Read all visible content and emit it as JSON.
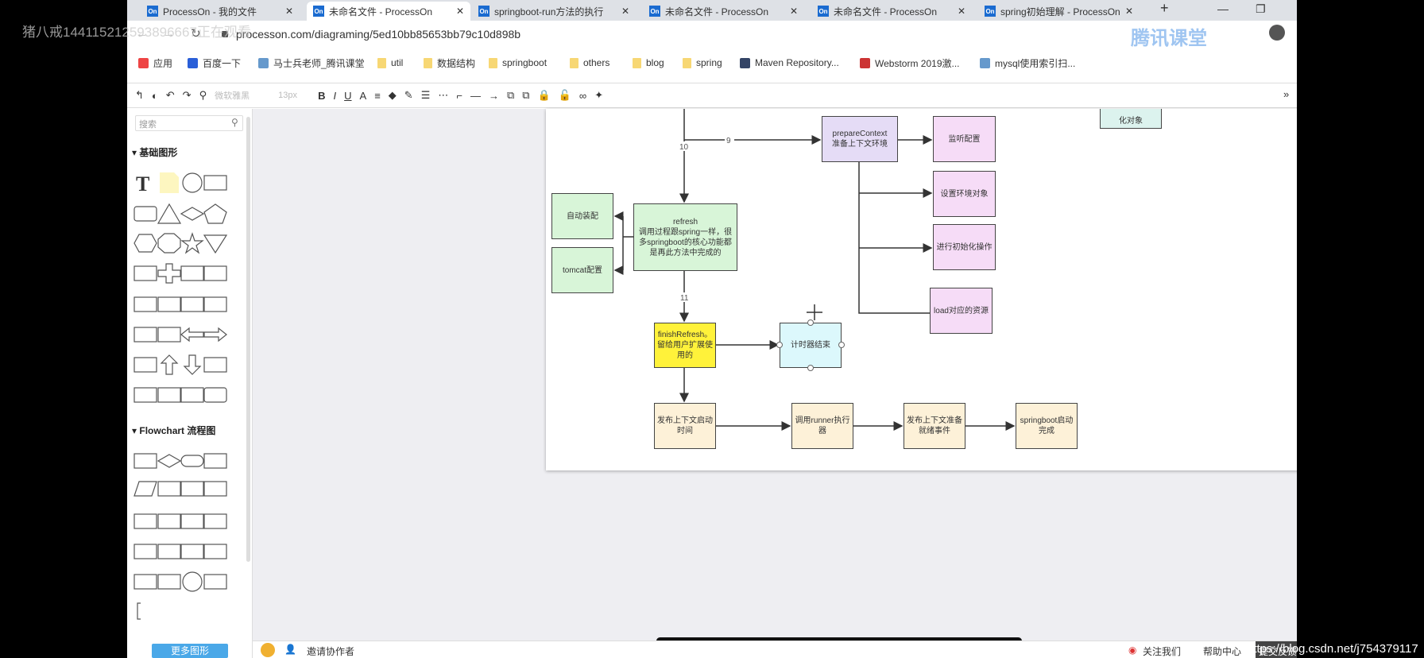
{
  "watermark_top": "猪八戒144115212593896667正在观看",
  "watermark_bottom": "https://blog.csdn.net/j754379117",
  "browser": {
    "tabs": [
      {
        "title": "ProcessOn - 我的文件",
        "active": false
      },
      {
        "title": "未命名文件 - ProcessOn",
        "active": true
      },
      {
        "title": "springboot-run方法的执行",
        "active": false
      },
      {
        "title": "未命名文件 - ProcessOn",
        "active": false
      },
      {
        "title": "未命名文件 - ProcessOn",
        "active": false
      },
      {
        "title": "spring初始理解 - ProcessOn",
        "active": false
      }
    ],
    "favicon": "On",
    "new_tab": "+",
    "url": "processon.com/diagraming/5ed10bb85653bb79c10d898b",
    "overlay_logo": "腾讯课堂",
    "bookmarks": [
      {
        "label": "应用",
        "icon": "apps-icon"
      },
      {
        "label": "百度一下",
        "icon": "baidu-icon"
      },
      {
        "label": "马士兵老师_腾讯课堂",
        "icon": "tencent-icon"
      },
      {
        "label": "util",
        "icon": "folder-icon"
      },
      {
        "label": "数据结构",
        "icon": "folder-icon"
      },
      {
        "label": "springboot",
        "icon": "folder-icon"
      },
      {
        "label": "others",
        "icon": "folder-icon"
      },
      {
        "label": "blog",
        "icon": "folder-icon"
      },
      {
        "label": "spring",
        "icon": "folder-icon"
      },
      {
        "label": "Maven Repository...",
        "icon": "maven-icon"
      },
      {
        "label": "Webstorm 2019激...",
        "icon": "webstorm-icon"
      },
      {
        "label": "mysql使用索引扫...",
        "icon": "mysql-icon"
      }
    ]
  },
  "toolbar": {
    "font": "微软雅黑",
    "size": "13px"
  },
  "sidebar": {
    "search_placeholder": "搜索",
    "section_basic": "基础图形",
    "section_flowchart": "Flowchart 流程图",
    "basic_shapes": [
      "text",
      "note",
      "circle",
      "rect",
      "rounded-rect",
      "triangle",
      "diamond",
      "pentagon",
      "hexagon",
      "octagon",
      "star",
      "inverted-triangle",
      "banner",
      "cross",
      "cloud",
      "speech",
      "brace-pair",
      "bracket-pair",
      "brace-right",
      "brace-left",
      "doc",
      "drop",
      "arrow-left",
      "arrow-right",
      "arrow-both",
      "arrow-up",
      "arrow-down",
      "arrow-updown",
      "u-arrow",
      "u-arrow-rev",
      "corner",
      "rect-small"
    ],
    "flow_shapes": [
      "process",
      "decision",
      "terminator",
      "document",
      "data",
      "predefined",
      "stored-data",
      "internal-storage",
      "sequential-data",
      "direct-data",
      "manual-input",
      "card",
      "tape",
      "preparation",
      "manual-operation",
      "display",
      "parallel",
      "loop-limit",
      "connector",
      "offpage",
      "annotation"
    ],
    "more_button": "更多图形"
  },
  "diagram": {
    "edge_labels": {
      "e9": "9",
      "e10": "10",
      "e11": "11"
    },
    "colors": {
      "lavender": "#e5dcf6",
      "pink": "#f6dcf7",
      "green": "#d8f5d8",
      "yellow": "#fff23a",
      "cyan": "#dcf8fc",
      "cream": "#fdf1d8",
      "teal": "#dcf3ee"
    },
    "nodes": {
      "hua": "化对象",
      "prepare": "prepareContext\n准备上下文环境",
      "listen": "监听配置",
      "env": "设置环境对象",
      "init": "进行初始化操作",
      "load": "load对应的资源",
      "refresh": "refresh\n调用过程跟spring一样，很多springboot的核心功能都是再此方法中完成的",
      "auto": "自动装配",
      "tomcat": "tomcat配置",
      "finish": "finishRefresh。留给用户扩展使用的",
      "timer": "计时器结束",
      "publish": "发布上下文启动时间",
      "runner": "调用runner执行器",
      "ready": "发布上下文准备就绪事件",
      "done": "springboot启动完成"
    }
  },
  "bottom": {
    "invite": "邀请协作者",
    "follow": "关注我们",
    "help": "帮助中心",
    "feedback": "提交反馈"
  }
}
